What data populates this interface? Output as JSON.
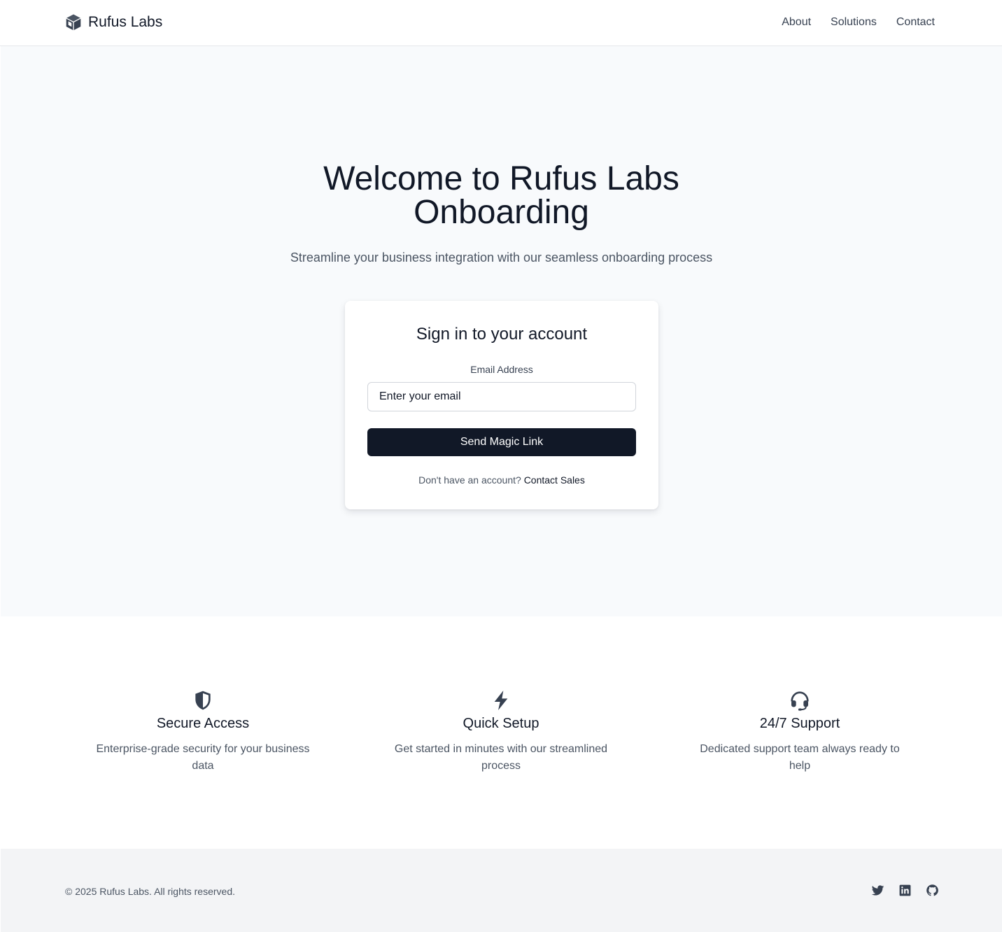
{
  "header": {
    "brand_name": "Rufus Labs",
    "nav": [
      {
        "label": "About"
      },
      {
        "label": "Solutions"
      },
      {
        "label": "Contact"
      }
    ]
  },
  "hero": {
    "title_line1": "Welcome to Rufus Labs",
    "title_line2": "Onboarding",
    "subtitle": "Streamline your business integration with our seamless onboarding process"
  },
  "signin": {
    "title": "Sign in to your account",
    "email_label": "Email Address",
    "email_placeholder": "Enter your email",
    "submit_label": "Send Magic Link",
    "no_account_text": "Don't have an account?",
    "contact_sales_label": "Contact Sales"
  },
  "features": [
    {
      "icon": "shield-icon",
      "title": "Secure Access",
      "description": "Enterprise-grade security for your business data"
    },
    {
      "icon": "bolt-icon",
      "title": "Quick Setup",
      "description": "Get started in minutes with our streamlined process"
    },
    {
      "icon": "headset-icon",
      "title": "24/7 Support",
      "description": "Dedicated support team always ready to help"
    }
  ],
  "footer": {
    "copyright": "© 2025 Rufus Labs. All rights reserved.",
    "social": [
      "twitter-icon",
      "linkedin-icon",
      "github-icon"
    ]
  },
  "colors": {
    "primary": "#111827",
    "hero_bg": "#f8fafc",
    "footer_bg": "#f3f4f6",
    "muted_text": "#4b5563"
  }
}
